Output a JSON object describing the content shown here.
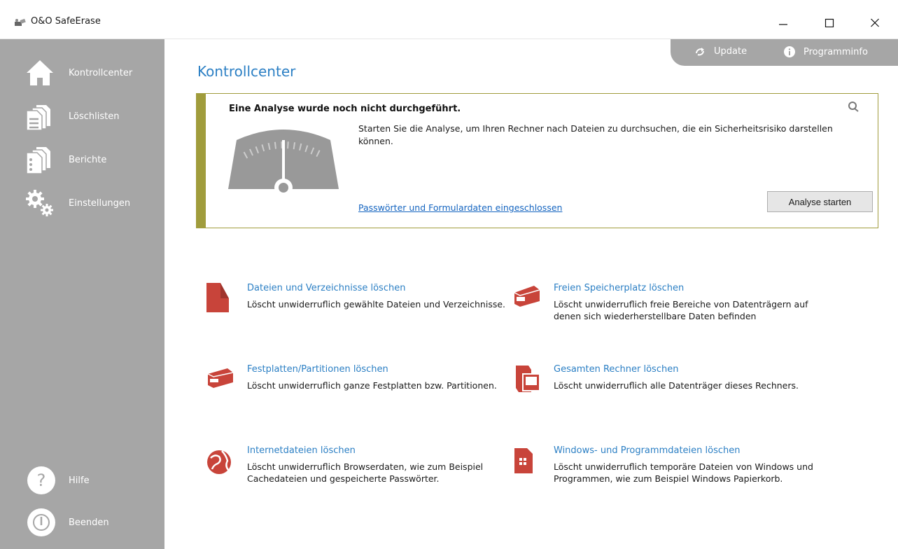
{
  "window": {
    "title": "O&O SafeErase",
    "controls": {
      "minimize": "minimize-icon",
      "maximize": "maximize-icon",
      "close": "close-icon"
    }
  },
  "sidebar": {
    "items": [
      {
        "label": "Kontrollcenter",
        "icon": "home-icon"
      },
      {
        "label": "Löschlisten",
        "icon": "lists-icon"
      },
      {
        "label": "Berichte",
        "icon": "reports-icon"
      },
      {
        "label": "Einstellungen",
        "icon": "gears-icon"
      }
    ],
    "bottom": [
      {
        "label": "Hilfe",
        "icon": "help-icon",
        "glyph": "?"
      },
      {
        "label": "Beenden",
        "icon": "power-icon"
      }
    ]
  },
  "toptab": {
    "update_label": "Update",
    "info_label": "Programminfo"
  },
  "main": {
    "title": "Kontrollcenter",
    "analysis": {
      "headline": "Eine Analyse wurde noch nicht durchgeführt.",
      "description": "Starten Sie die Analyse, um Ihren Rechner nach Dateien zu durchsuchen, die ein Sicherheitsrisiko darstellen können.",
      "link": "Passwörter und Formulardaten eingeschlossen",
      "button": "Analyse starten"
    },
    "actions": [
      {
        "title": "Dateien und Verzeichnisse löschen",
        "description": "Löscht unwiderruflich gewählte Dateien und Verzeichnisse."
      },
      {
        "title": "Freien Speicherplatz löschen",
        "description": "Löscht unwiderruflich freie Bereiche von Datenträgern auf denen sich wiederherstellbare Daten befinden"
      },
      {
        "title": "Festplatten/Partitionen löschen",
        "description": "Löscht unwiderruflich ganze Festplatten bzw. Partitionen."
      },
      {
        "title": "Gesamten Rechner löschen",
        "description": "Löscht unwiderruflich alle Datenträger dieses Rechners."
      },
      {
        "title": "Internetdateien löschen",
        "description": "Löscht unwiderruflich Browserdaten, wie zum Beispiel Cachedateien und gespeicherte Passwörter."
      },
      {
        "title": "Windows- und Programmdateien löschen",
        "description": "Löscht unwiderruflich temporäre Dateien von Windows und Programmen, wie zum Beispiel Windows Papierkorb."
      }
    ]
  },
  "colors": {
    "sidebar": "#a6a6a6",
    "accent_blue": "#2b7fc4",
    "panel_border": "#a09c3c",
    "icon_red": "#c8443a"
  }
}
